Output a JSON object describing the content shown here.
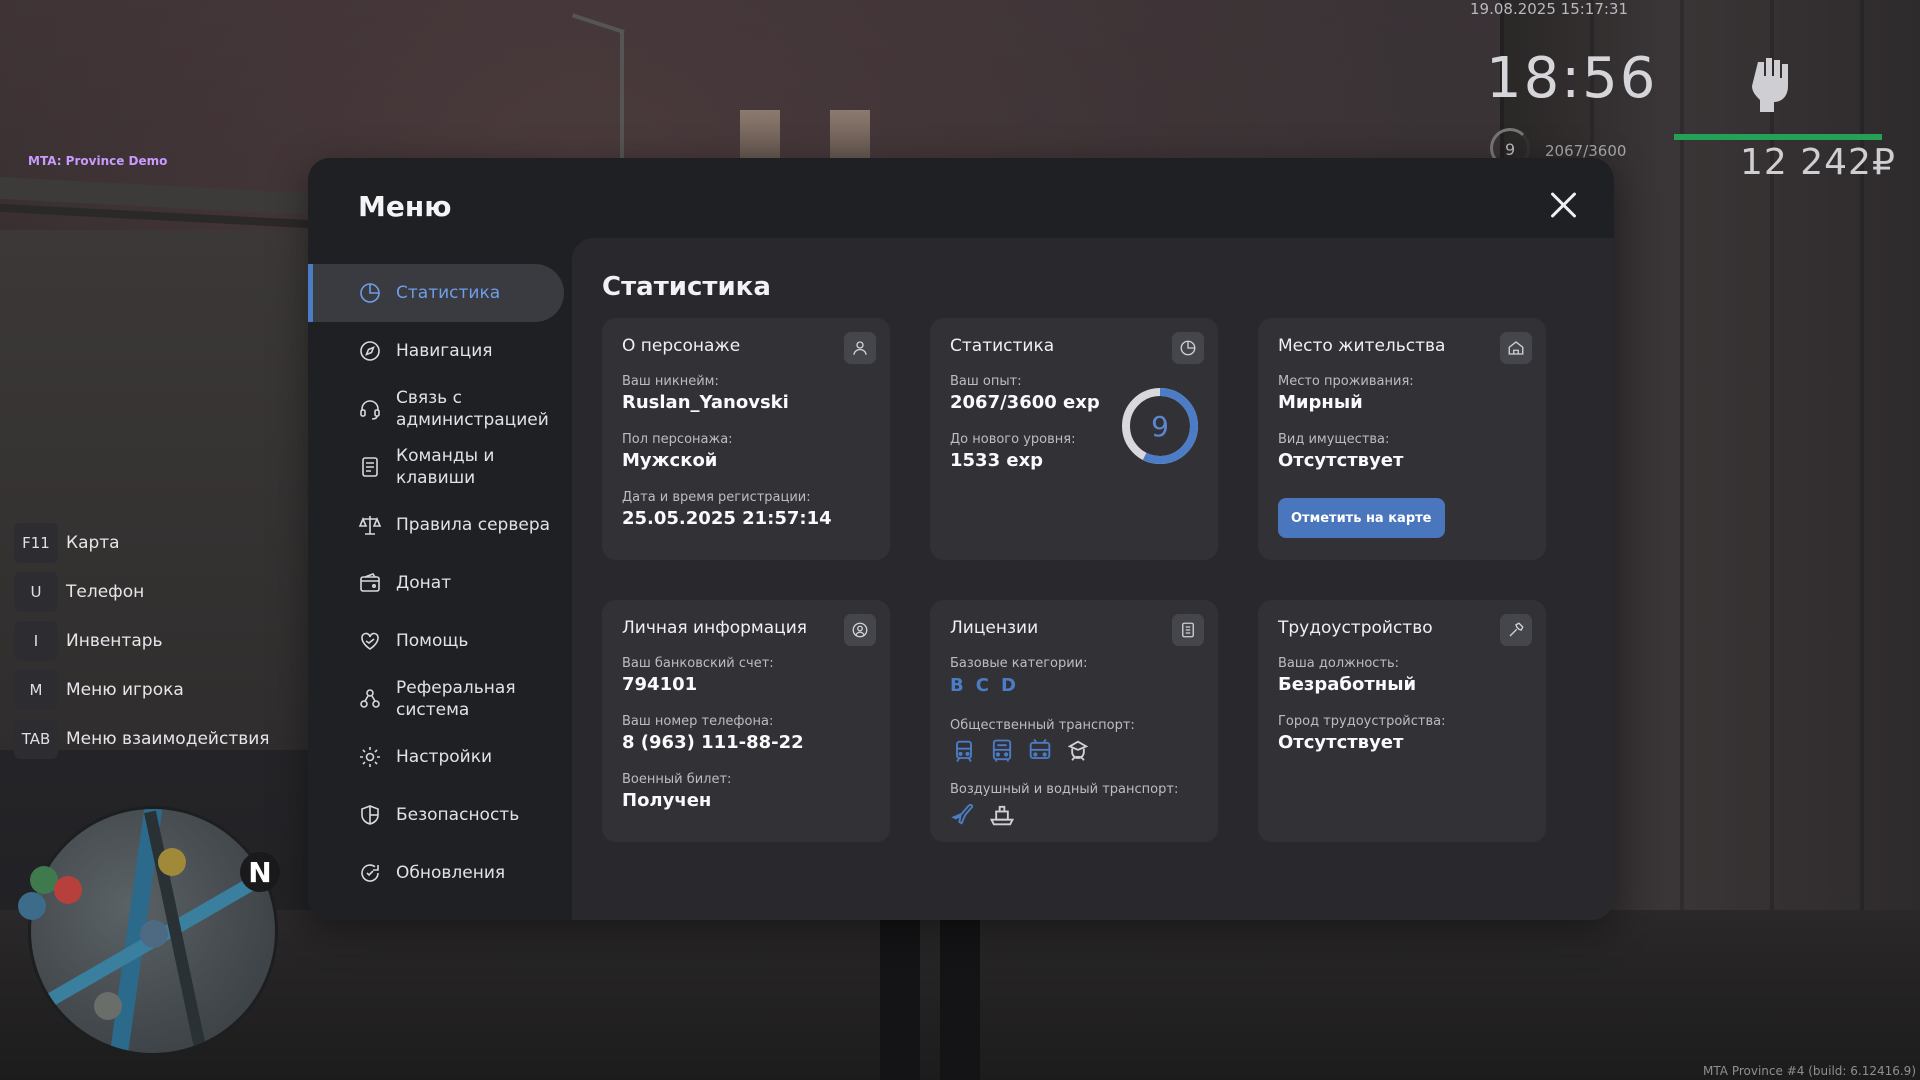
{
  "hud": {
    "server_name": "MTA: Province Demo",
    "datetime": "19.08.2025 15:17:31",
    "time": "18:56",
    "level": "9",
    "exp": "2067/3600",
    "money": "12 242₽",
    "health_fraction": 1.0,
    "build": "MTA Province #4 (build: 6.12416.9)"
  },
  "hotkeys": [
    {
      "key": "F11",
      "label": "Карта"
    },
    {
      "key": "U",
      "label": "Телефон"
    },
    {
      "key": "I",
      "label": "Инвентарь"
    },
    {
      "key": "M",
      "label": "Меню игрока"
    },
    {
      "key": "TAB",
      "label": "Меню взаимодействия"
    }
  ],
  "minimap": {
    "north": "N"
  },
  "menu": {
    "title": "Меню",
    "nav": [
      {
        "label": "Статистика",
        "icon": "chart-pie-icon",
        "active": true
      },
      {
        "label": "Навигация",
        "icon": "compass-icon"
      },
      {
        "label": "Связь с администрацией",
        "icon": "headset-icon"
      },
      {
        "label": "Команды и клавиши",
        "icon": "document-icon"
      },
      {
        "label": "Правила сервера",
        "icon": "scales-icon"
      },
      {
        "label": "Донат",
        "icon": "wallet-icon"
      },
      {
        "label": "Помощь",
        "icon": "heart-hand-icon"
      },
      {
        "label": "Реферальная система",
        "icon": "people-icon"
      },
      {
        "label": "Настройки",
        "icon": "gear-icon"
      },
      {
        "label": "Безопасность",
        "icon": "shield-icon"
      },
      {
        "label": "Обновления",
        "icon": "refresh-icon"
      }
    ]
  },
  "content": {
    "title": "Статистика",
    "character": {
      "title": "О персонаже",
      "nickname_label": "Ваш никнейм:",
      "nickname": "Ruslan_Yanovski",
      "gender_label": "Пол персонажа:",
      "gender": "Мужской",
      "reg_label": "Дата и время регистрации:",
      "reg": "25.05.2025 21:57:14"
    },
    "stats": {
      "title": "Статистика",
      "exp_label": "Ваш опыт:",
      "exp": "2067/3600 exp",
      "next_label": "До нового уровня:",
      "next": "1533 exp",
      "level": "9",
      "progress_fraction": 0.574
    },
    "residence": {
      "title": "Место жительства",
      "place_label": "Место проживания:",
      "place": "Мирный",
      "property_label": "Вид имущества:",
      "property": "Отсутствует",
      "button": "Отметить на карте"
    },
    "personal": {
      "title": "Личная информация",
      "bank_label": "Ваш банковский счет:",
      "bank": "794101",
      "phone_label": "Ваш номер телефона:",
      "phone": "8 (963) 111-88-22",
      "military_label": "Военный билет:",
      "military": "Получен"
    },
    "licenses": {
      "title": "Лицензии",
      "base_label": "Базовые категории:",
      "base": [
        "B",
        "C",
        "D"
      ],
      "public_label": "Общественный транспорт:",
      "air_label": "Воздушный и водный транспорт:"
    },
    "job": {
      "title": "Трудоустройство",
      "position_label": "Ваша должность:",
      "position": "Безработный",
      "city_label": "Город трудоустройства:",
      "city": "Отсутствует"
    }
  },
  "colors": {
    "accent": "#4d7cc7",
    "health": "#25a157",
    "server_name": "#c79bff"
  }
}
